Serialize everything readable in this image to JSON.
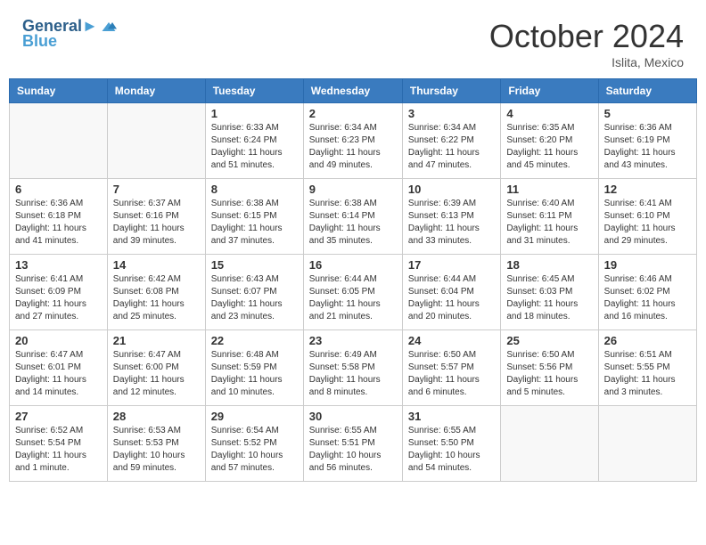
{
  "header": {
    "logo_line1": "General",
    "logo_line2": "Blue",
    "month_title": "October 2024",
    "location": "Islita, Mexico"
  },
  "days_of_week": [
    "Sunday",
    "Monday",
    "Tuesday",
    "Wednesday",
    "Thursday",
    "Friday",
    "Saturday"
  ],
  "weeks": [
    [
      {
        "day": "",
        "info": ""
      },
      {
        "day": "",
        "info": ""
      },
      {
        "day": "1",
        "info": "Sunrise: 6:33 AM\nSunset: 6:24 PM\nDaylight: 11 hours and 51 minutes."
      },
      {
        "day": "2",
        "info": "Sunrise: 6:34 AM\nSunset: 6:23 PM\nDaylight: 11 hours and 49 minutes."
      },
      {
        "day": "3",
        "info": "Sunrise: 6:34 AM\nSunset: 6:22 PM\nDaylight: 11 hours and 47 minutes."
      },
      {
        "day": "4",
        "info": "Sunrise: 6:35 AM\nSunset: 6:20 PM\nDaylight: 11 hours and 45 minutes."
      },
      {
        "day": "5",
        "info": "Sunrise: 6:36 AM\nSunset: 6:19 PM\nDaylight: 11 hours and 43 minutes."
      }
    ],
    [
      {
        "day": "6",
        "info": "Sunrise: 6:36 AM\nSunset: 6:18 PM\nDaylight: 11 hours and 41 minutes."
      },
      {
        "day": "7",
        "info": "Sunrise: 6:37 AM\nSunset: 6:16 PM\nDaylight: 11 hours and 39 minutes."
      },
      {
        "day": "8",
        "info": "Sunrise: 6:38 AM\nSunset: 6:15 PM\nDaylight: 11 hours and 37 minutes."
      },
      {
        "day": "9",
        "info": "Sunrise: 6:38 AM\nSunset: 6:14 PM\nDaylight: 11 hours and 35 minutes."
      },
      {
        "day": "10",
        "info": "Sunrise: 6:39 AM\nSunset: 6:13 PM\nDaylight: 11 hours and 33 minutes."
      },
      {
        "day": "11",
        "info": "Sunrise: 6:40 AM\nSunset: 6:11 PM\nDaylight: 11 hours and 31 minutes."
      },
      {
        "day": "12",
        "info": "Sunrise: 6:41 AM\nSunset: 6:10 PM\nDaylight: 11 hours and 29 minutes."
      }
    ],
    [
      {
        "day": "13",
        "info": "Sunrise: 6:41 AM\nSunset: 6:09 PM\nDaylight: 11 hours and 27 minutes."
      },
      {
        "day": "14",
        "info": "Sunrise: 6:42 AM\nSunset: 6:08 PM\nDaylight: 11 hours and 25 minutes."
      },
      {
        "day": "15",
        "info": "Sunrise: 6:43 AM\nSunset: 6:07 PM\nDaylight: 11 hours and 23 minutes."
      },
      {
        "day": "16",
        "info": "Sunrise: 6:44 AM\nSunset: 6:05 PM\nDaylight: 11 hours and 21 minutes."
      },
      {
        "day": "17",
        "info": "Sunrise: 6:44 AM\nSunset: 6:04 PM\nDaylight: 11 hours and 20 minutes."
      },
      {
        "day": "18",
        "info": "Sunrise: 6:45 AM\nSunset: 6:03 PM\nDaylight: 11 hours and 18 minutes."
      },
      {
        "day": "19",
        "info": "Sunrise: 6:46 AM\nSunset: 6:02 PM\nDaylight: 11 hours and 16 minutes."
      }
    ],
    [
      {
        "day": "20",
        "info": "Sunrise: 6:47 AM\nSunset: 6:01 PM\nDaylight: 11 hours and 14 minutes."
      },
      {
        "day": "21",
        "info": "Sunrise: 6:47 AM\nSunset: 6:00 PM\nDaylight: 11 hours and 12 minutes."
      },
      {
        "day": "22",
        "info": "Sunrise: 6:48 AM\nSunset: 5:59 PM\nDaylight: 11 hours and 10 minutes."
      },
      {
        "day": "23",
        "info": "Sunrise: 6:49 AM\nSunset: 5:58 PM\nDaylight: 11 hours and 8 minutes."
      },
      {
        "day": "24",
        "info": "Sunrise: 6:50 AM\nSunset: 5:57 PM\nDaylight: 11 hours and 6 minutes."
      },
      {
        "day": "25",
        "info": "Sunrise: 6:50 AM\nSunset: 5:56 PM\nDaylight: 11 hours and 5 minutes."
      },
      {
        "day": "26",
        "info": "Sunrise: 6:51 AM\nSunset: 5:55 PM\nDaylight: 11 hours and 3 minutes."
      }
    ],
    [
      {
        "day": "27",
        "info": "Sunrise: 6:52 AM\nSunset: 5:54 PM\nDaylight: 11 hours and 1 minute."
      },
      {
        "day": "28",
        "info": "Sunrise: 6:53 AM\nSunset: 5:53 PM\nDaylight: 10 hours and 59 minutes."
      },
      {
        "day": "29",
        "info": "Sunrise: 6:54 AM\nSunset: 5:52 PM\nDaylight: 10 hours and 57 minutes."
      },
      {
        "day": "30",
        "info": "Sunrise: 6:55 AM\nSunset: 5:51 PM\nDaylight: 10 hours and 56 minutes."
      },
      {
        "day": "31",
        "info": "Sunrise: 6:55 AM\nSunset: 5:50 PM\nDaylight: 10 hours and 54 minutes."
      },
      {
        "day": "",
        "info": ""
      },
      {
        "day": "",
        "info": ""
      }
    ]
  ]
}
